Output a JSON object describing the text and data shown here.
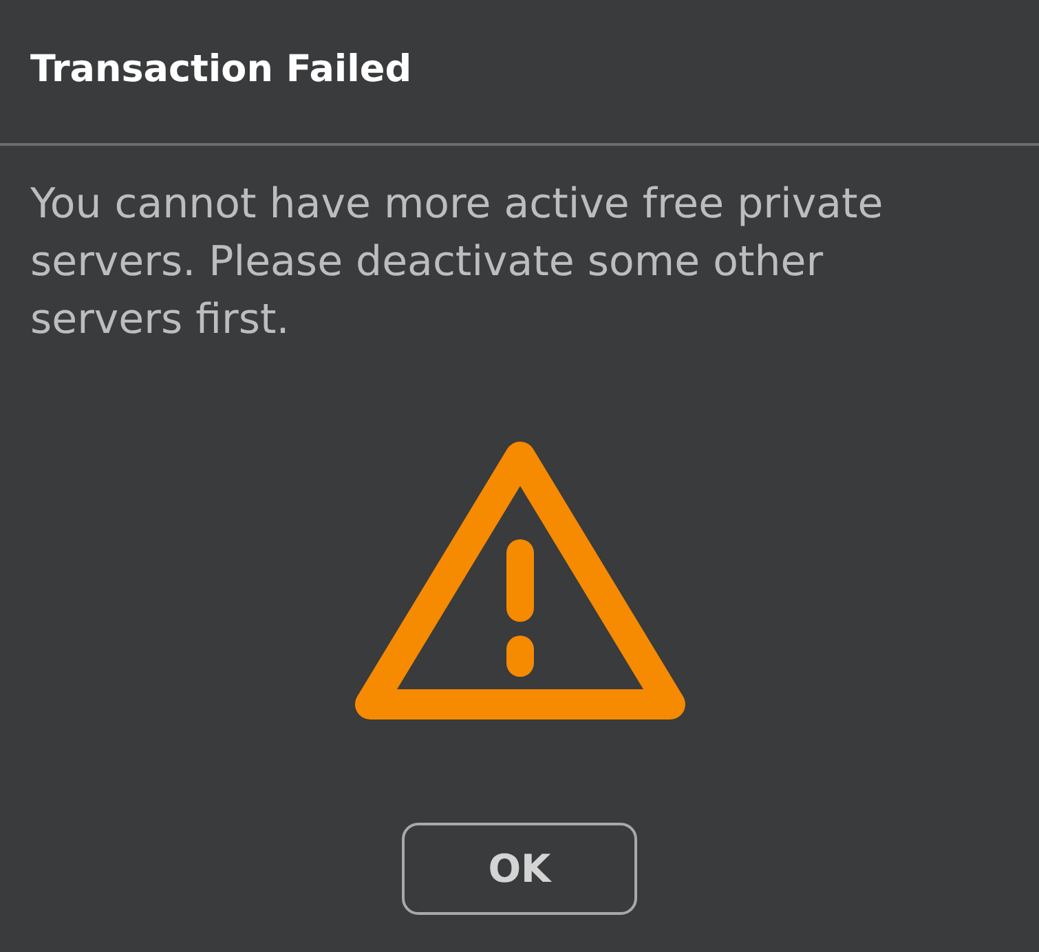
{
  "dialog": {
    "title": "Transaction Failed",
    "message": "You cannot have more active free private servers. Please deactivate some other servers first.",
    "buttons": [
      {
        "label": "OK"
      }
    ]
  }
}
